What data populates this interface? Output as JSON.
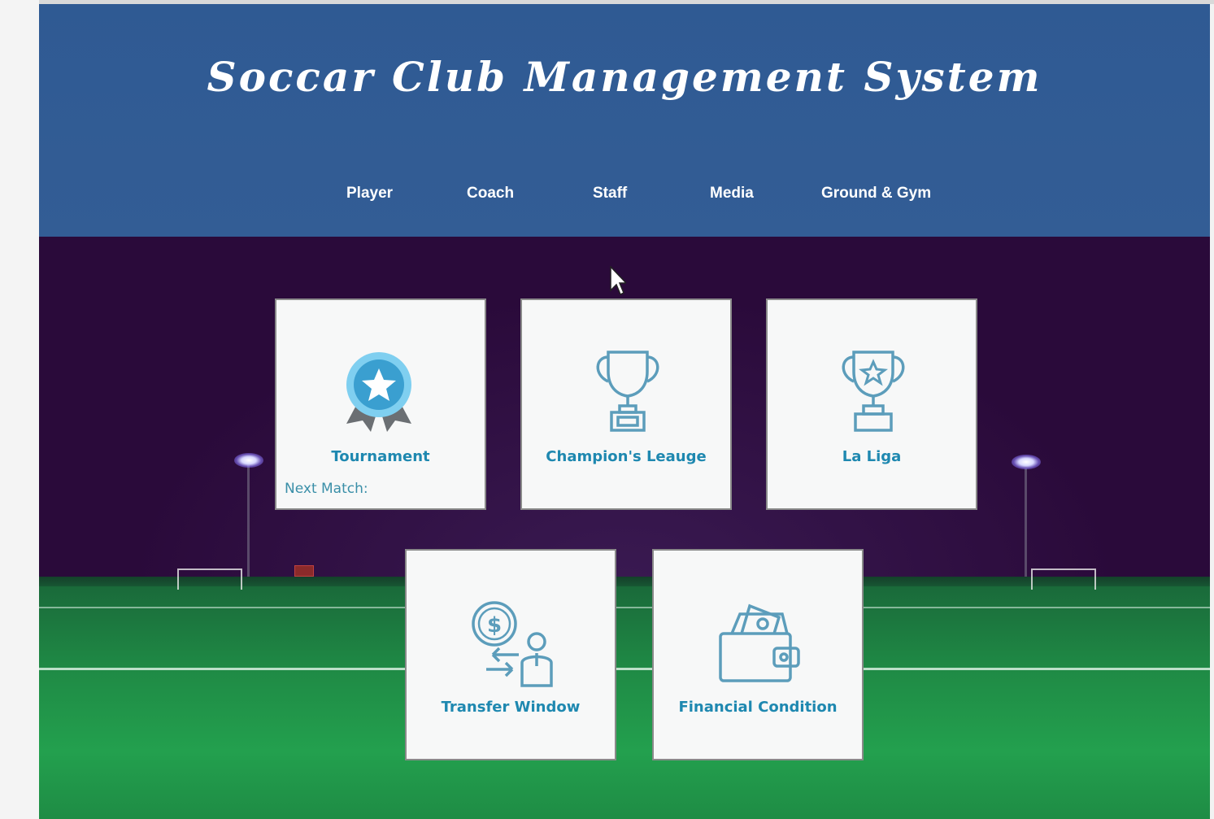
{
  "app": {
    "title": "Soccar Club Management System"
  },
  "nav": {
    "items": [
      {
        "label": "Player"
      },
      {
        "label": "Coach"
      },
      {
        "label": "Staff"
      },
      {
        "label": "Media"
      },
      {
        "label": "Ground & Gym"
      }
    ]
  },
  "cards": [
    {
      "label": "Tournament",
      "sub": "Next Match:",
      "icon": "award-ribbon-icon"
    },
    {
      "label": "Champion's Leauge",
      "icon": "trophy-icon"
    },
    {
      "label": "La Liga",
      "icon": "star-trophy-icon"
    },
    {
      "label": "Transfer Window",
      "icon": "transfer-icon"
    },
    {
      "label": "Financial Condition",
      "icon": "wallet-icon"
    }
  ],
  "colors": {
    "header": "#335d95",
    "card_text": "#1e88b0",
    "icon_stroke": "#5c9dbb"
  }
}
